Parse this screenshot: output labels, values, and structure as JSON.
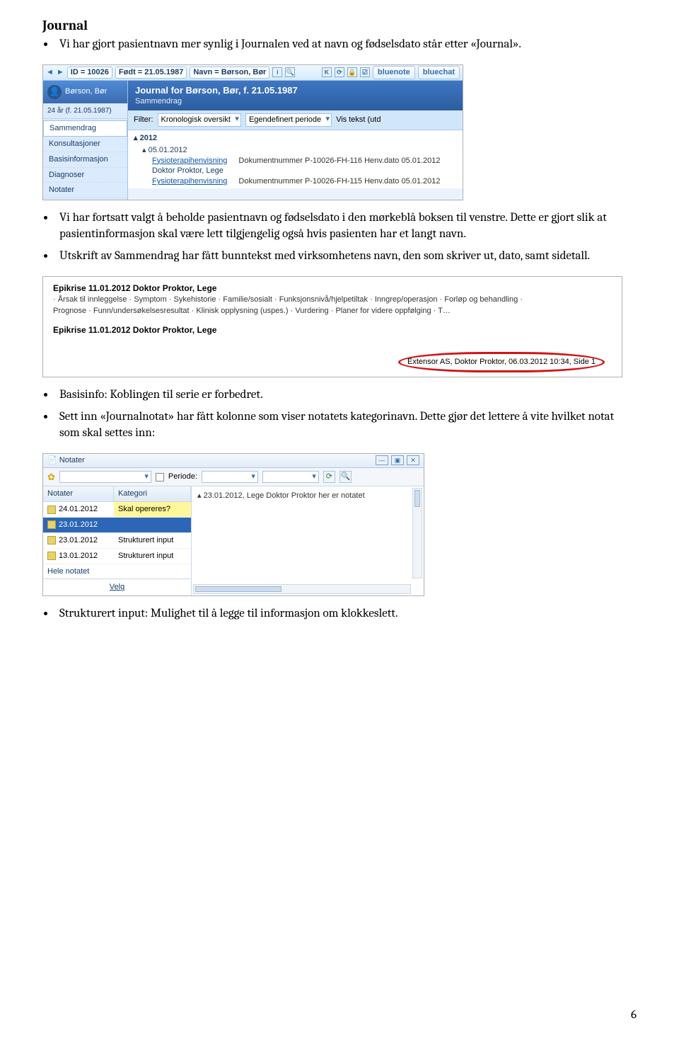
{
  "heading": "Journal",
  "bullets": {
    "intro": "Vi har gjort pasientnavn mer synlig i Journalen ved at navn og fødselsdato står etter «Journal».",
    "keep": "Vi har fortsatt valgt å beholde pasientnavn og fødselsdato i den mørkeblå boksen til venstre. Dette er gjort slik at pasientinformasjon skal være lett tilgjengelig også hvis pasienten har et langt navn.",
    "footer": "Utskrift av Sammendrag har fått bunntekst med virksomhetens navn, den som skriver ut, dato, samt sidetall.",
    "basis": "Basisinfo: Koblingen til serie er forbedret.",
    "notat": "Sett inn «Journalnotat» har fått kolonne som viser notatets kategorinavn. Dette gjør det lettere å vite hvilket notat som skal settes inn:",
    "struct": "Strukturert input: Mulighet til å legge til informasjon om klokkeslett."
  },
  "ss1": {
    "id_label": "ID = 10026",
    "fodt_label": "Født = 21.05.1987",
    "navn_label": "Navn = Børson, Bør",
    "bluenote": "bluenote",
    "bluechat": "bluechat",
    "patient": "Børson, Bør",
    "age": "24 år (f. 21.05.1987)",
    "sidebar": [
      "Sammendrag",
      "Konsultasjoner",
      "Basisinformasjon",
      "Diagnoser",
      "Notater"
    ],
    "title": "Journal for Børson, Bør, f. 21.05.1987",
    "subtitle": "Sammendrag",
    "filter_label": "Filter:",
    "filter_view": "Kronologisk oversikt",
    "filter_period": "Egendefinert periode",
    "filter_text": "Vis tekst (utd",
    "year": "2012",
    "date": "05.01.2012",
    "rows": [
      {
        "link": "Fysioterapihenvisning",
        "sub": "Doktor Proktor, Lege",
        "doc": "Dokumentnummer P-10026-FH-116  Henv.dato 05.01.2012"
      },
      {
        "link": "Fysioterapihenvisning",
        "sub": "",
        "doc": "Dokumentnummer P-10026-FH-115  Henv.dato 05.01.2012"
      }
    ]
  },
  "ss2": {
    "h1": "Epikrise  11.01.2012 Doktor Proktor, Lege",
    "l1": "· Årsak til innleggelse · Symptom · Sykehistorie · Familie/sosialt · Funksjonsnivå/hjelpetiltak · Inngrep/operasjon · Forløp og behandling ·",
    "l2": "Prognose · Funn/undersøkelsesresultat · Klinisk opplysning (uspes.) · Vurdering · Planer for videre oppfølging · T…",
    "h2": "Epikrise  11.01.2012 Doktor Proktor, Lege",
    "footer": "Extensor AS, Doktor Proktor, 06.03.2012 10:34, Side 1"
  },
  "ss3": {
    "title": "Notater",
    "periode": "Periode:",
    "th1": "Notater",
    "th2": "Kategori",
    "preview": "23.01.2012, Lege Doktor Proktor her er notatet",
    "rows": [
      {
        "date": "24.01.2012",
        "cat": "Skal opereres?",
        "hl": true
      },
      {
        "date": "23.01.2012",
        "cat": "",
        "sel": true
      },
      {
        "date": "23.01.2012",
        "cat": "Strukturert input"
      },
      {
        "date": "13.01.2012",
        "cat": "Strukturert input"
      }
    ],
    "hele": "Hele notatet",
    "velg": "Velg"
  },
  "page_number": "6"
}
